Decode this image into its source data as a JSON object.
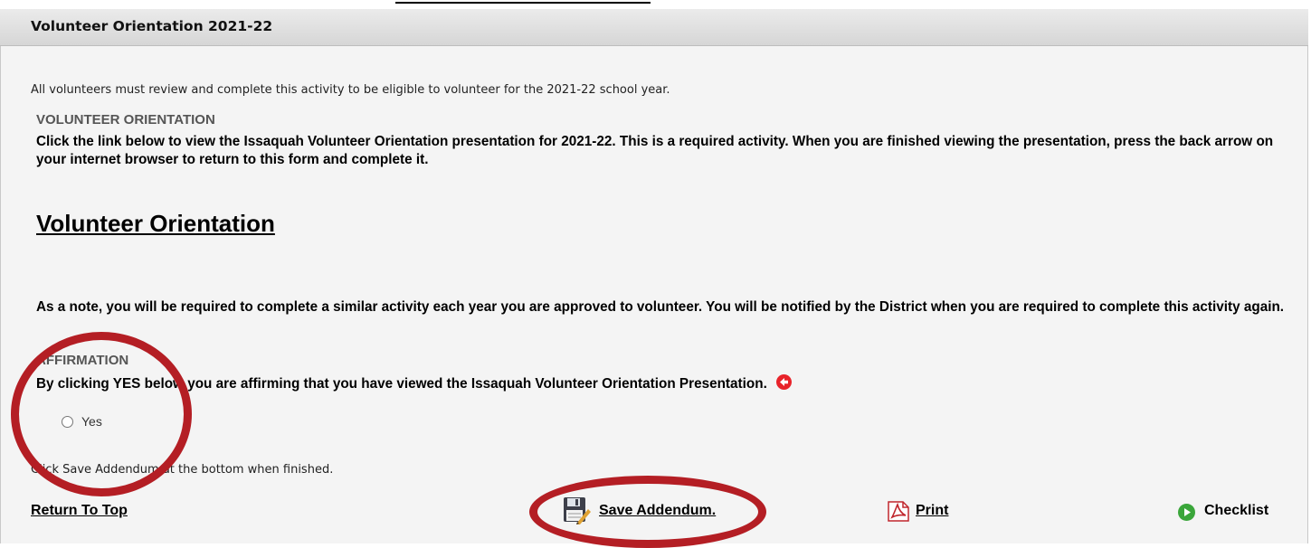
{
  "panel": {
    "title": "Volunteer Orientation 2021-22"
  },
  "intro": "All volunteers must review and complete this activity to be eligible to volunteer for the 2021-22 school year.",
  "orientation_section": {
    "label": "VOLUNTEER ORIENTATION",
    "instructions": "Click the link below to view the Issaquah Volunteer Orientation presentation for 2021-22. This is a required activity. When you are finished viewing the presentation, press the back arrow on your internet browser to return to this form and complete it.",
    "link_text": "Volunteer Orientation",
    "note": "As a note, you will be required to complete a similar activity each year you are approved to volunteer. You will be notified by the District when you are required to complete this activity again."
  },
  "affirmation_section": {
    "label": "AFFIRMATION",
    "text": "By clicking YES below you are affirming that you have viewed the Issaquah Volunteer Orientation Presentation.",
    "option": "Yes",
    "required_icon": "required-arrow-icon"
  },
  "save_hint": "Click Save Addendum at the bottom when finished.",
  "footer": {
    "return_top": "Return To Top",
    "save_addendum": "Save Addendum.",
    "print": "Print",
    "checklist": "Checklist"
  },
  "colors": {
    "annotation": "#b41e24",
    "required": "#e8232a",
    "checklist": "#3aa63a"
  }
}
